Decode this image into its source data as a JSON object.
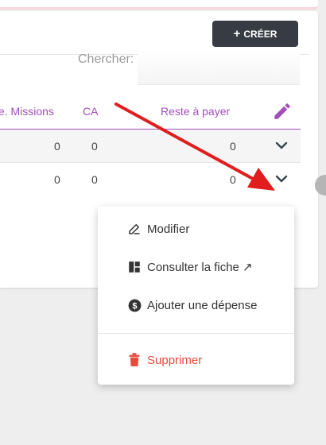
{
  "toolbar": {
    "create_label": "CRÉER"
  },
  "search": {
    "label": "Chercher:",
    "value": ""
  },
  "table": {
    "headers": [
      ".e. Missions",
      "CA",
      "Reste à payer"
    ],
    "rows": [
      {
        "missions": "0",
        "ca": "0",
        "reste": "0"
      },
      {
        "missions": "0",
        "ca": "0",
        "reste": "0"
      }
    ]
  },
  "menu": {
    "items": [
      {
        "label": "Modifier",
        "icon": "pen-icon"
      },
      {
        "label": "Consulter la fiche ↗",
        "icon": "layout-icon"
      },
      {
        "label": "Ajouter une dépense",
        "icon": "dollar-circle-icon"
      },
      {
        "label": "Supprimer",
        "icon": "trash-icon"
      }
    ]
  },
  "colors": {
    "accent": "#a050b8",
    "danger": "#e74b3c",
    "button": "#363b44",
    "arrow": "#e11d1d"
  }
}
